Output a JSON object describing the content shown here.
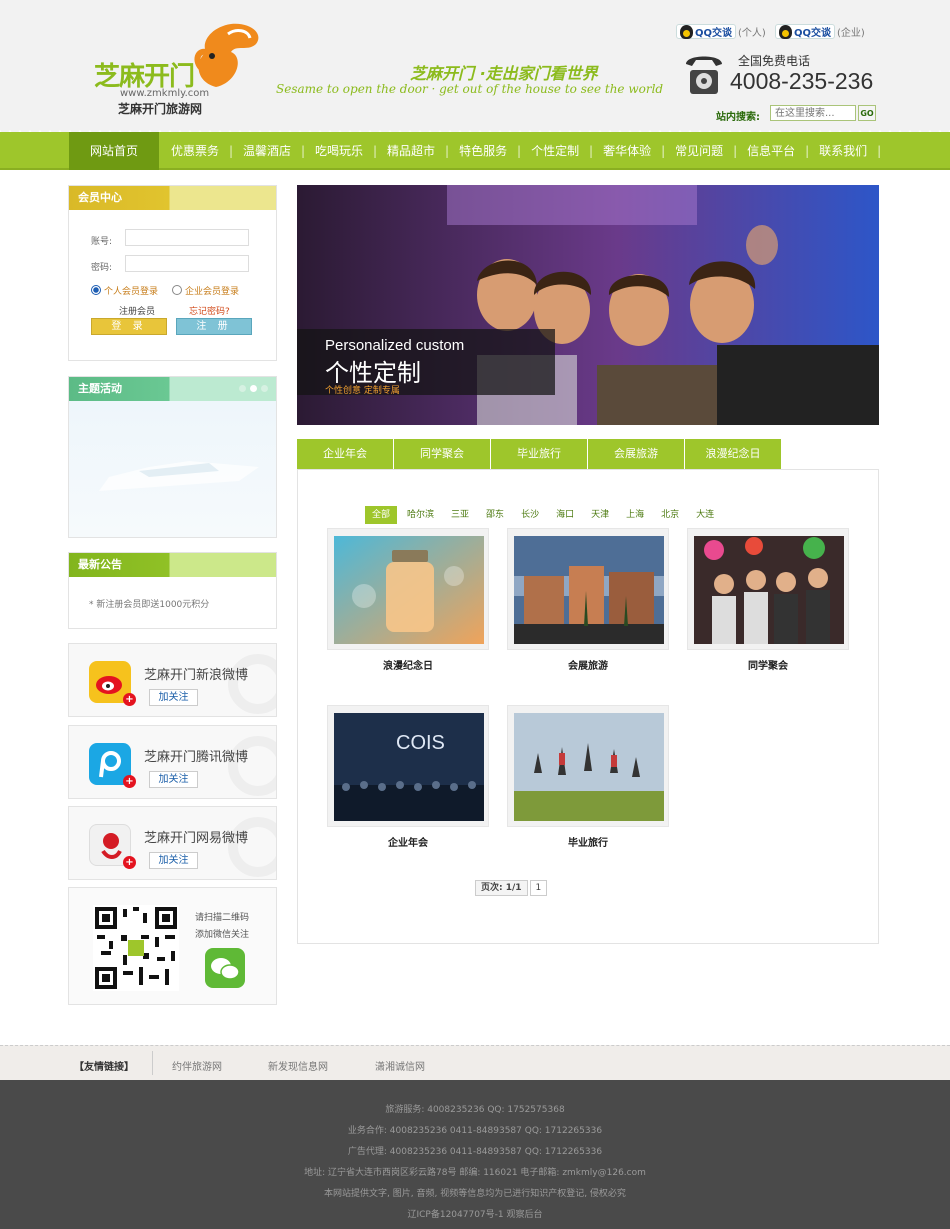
{
  "header": {
    "logo_name": "芝麻开门",
    "logo_url": "www.zmkmly.com",
    "logo_cn": "芝麻开门旅游网",
    "slogan": "芝麻开门 ·走出家门看世界",
    "slogan_en": "Sesame to open the door · get out of the house to see the world",
    "qq_label": "QQ交谈",
    "qq_personal": "(个人)",
    "qq_company": "(企业)",
    "hotline_label": "全国免费电话",
    "hotline": "4008-235-236",
    "search_label": "站内搜索:",
    "search_placeholder": "在这里搜索...",
    "search_button": "GO"
  },
  "nav": [
    "网站首页",
    "优惠票务",
    "温馨酒店",
    "吃喝玩乐",
    "精品超市",
    "特色服务",
    "个性定制",
    "奢华体验",
    "常见问题",
    "信息平台",
    "联系我们"
  ],
  "sidebar": {
    "member": {
      "title": "会员中心",
      "account": "账号:",
      "password": "密码:",
      "personal_login": "个人会员登录",
      "company_login": "企业会员登录",
      "register_member": "注册会员",
      "forgot": "忘记密码?",
      "login_btn": "登 录",
      "register_btn": "注 册"
    },
    "theme_title": "主题活动",
    "notice_title": "最新公告",
    "notice_text": "* 新注册会员即送1000元积分",
    "social": [
      {
        "name": "芝麻开门新浪微博",
        "follow": "加关注"
      },
      {
        "name": "芝麻开门腾讯微博",
        "follow": "加关注"
      },
      {
        "name": "芝麻开门网易微博",
        "follow": "加关注"
      }
    ],
    "wechat_line1": "请扫描二维码",
    "wechat_line2": "添加微信关注"
  },
  "banner": {
    "en": "Personalized custom",
    "cn": "个性定制",
    "sub": "个性创意 定制专属"
  },
  "tabs": [
    "企业年会",
    "同学聚会",
    "毕业旅行",
    "会展旅游",
    "浪漫纪念日"
  ],
  "cities": [
    "全部",
    "哈尔滨",
    "三亚",
    "邵东",
    "长沙",
    "海口",
    "天津",
    "上海",
    "北京",
    "大连"
  ],
  "cards": [
    "浪漫纪念日",
    "会展旅游",
    "同学聚会",
    "企业年会",
    "毕业旅行"
  ],
  "pager": {
    "label": "页次: 1/1",
    "page": "1"
  },
  "footer": {
    "links_title": "【友情链接】",
    "links": [
      "约伴旅游网",
      "新发现信息网",
      "潇湘诚信网"
    ],
    "lines": [
      "旅游服务: 4008235236 QQ: 1752575368",
      "业务合作: 4008235236 0411-84893587 QQ: 1712265336",
      "广告代理: 4008235236 0411-84893587 QQ: 1712265336",
      "地址: 辽宁省大连市西岗区彩云路78号 邮编: 116021 电子邮箱: zmkmly@126.com",
      "本网站提供文字, 图片, 音频, 视频等信息均为已进行知识产权登记, 侵权必究",
      "辽ICP备12047707号-1 观察后台"
    ]
  },
  "colors": {
    "brand_green": "#9ec62b",
    "nav_active": "#6f9a12",
    "accent_yellow": "#e1c42e"
  }
}
